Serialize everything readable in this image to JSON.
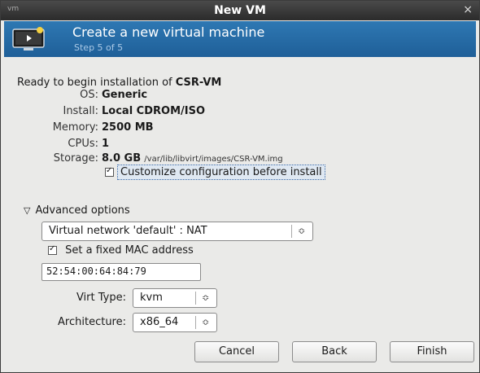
{
  "titlebar": {
    "title": "New VM",
    "app_icon": "vm",
    "close": "×"
  },
  "banner": {
    "headline": "Create a new virtual machine",
    "step": "Step 5 of 5"
  },
  "summary": {
    "ready_prefix": "Ready to begin installation of ",
    "vm_name": "CSR-VM",
    "rows": [
      {
        "label": "OS:",
        "value": "Generic"
      },
      {
        "label": "Install:",
        "value": "Local CDROM/ISO"
      },
      {
        "label": "Memory:",
        "value": "2500 MB"
      },
      {
        "label": "CPUs:",
        "value": "1"
      },
      {
        "label": "Storage:",
        "value": "8.0 GB",
        "path": "/var/lib/libvirt/images/CSR-VM.img"
      }
    ],
    "customize_label": "Customize configuration before install",
    "customize_checked": true
  },
  "advanced": {
    "label": "Advanced options",
    "network": "Virtual network 'default' : NAT",
    "fixed_mac_label": "Set a fixed MAC address",
    "fixed_mac_checked": true,
    "mac_value": "52:54:00:64:84:79",
    "virt_type_label": "Virt Type:",
    "virt_type": "kvm",
    "arch_label": "Architecture:",
    "arch": "x86_64"
  },
  "buttons": {
    "cancel": "Cancel",
    "back": "Back",
    "finish": "Finish"
  },
  "colors": {
    "banner": "#2566a3",
    "titlebar": "#333333",
    "window_bg": "#eaeae8"
  }
}
